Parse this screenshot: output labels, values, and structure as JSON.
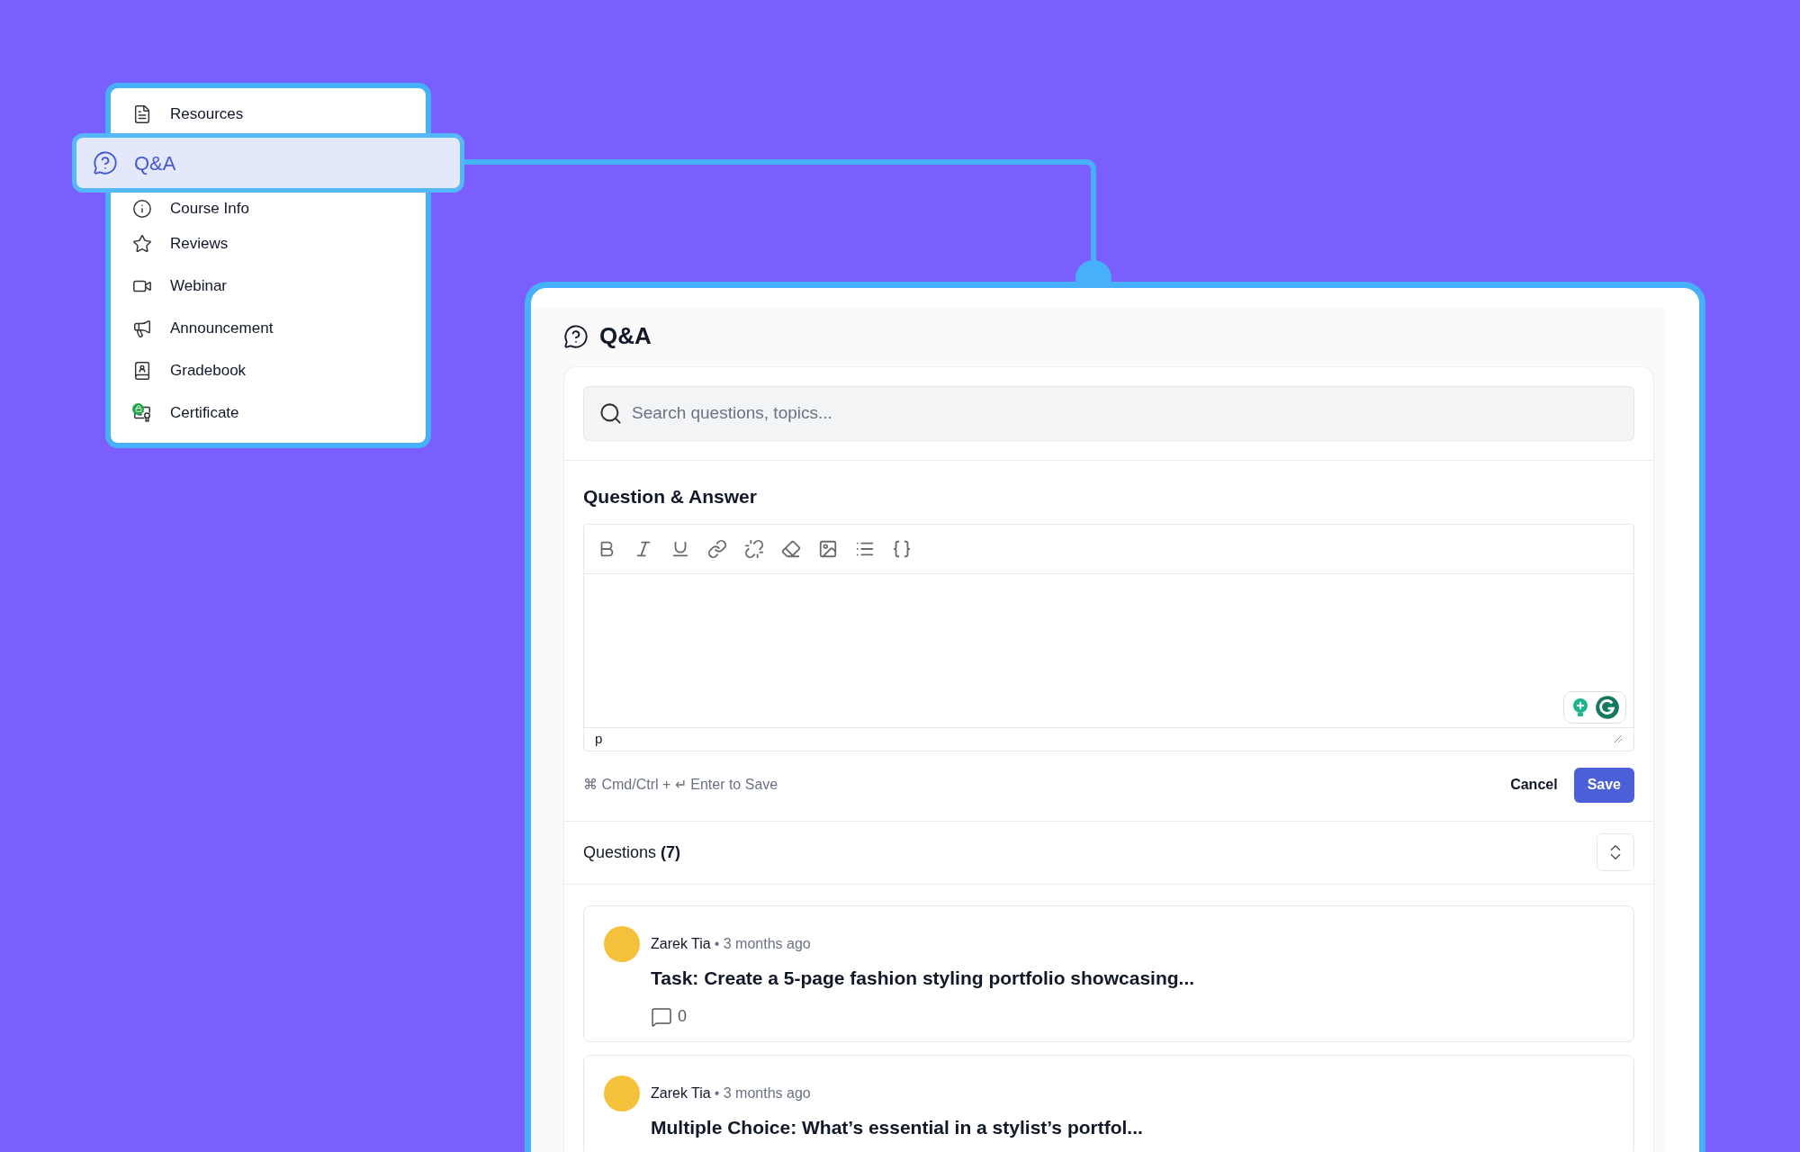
{
  "sidebar": {
    "items": [
      {
        "label": "Resources",
        "selected": false,
        "locked": false
      },
      {
        "label": "Q&A",
        "selected": true,
        "locked": false
      },
      {
        "label": "Course Info",
        "selected": false,
        "locked": false
      },
      {
        "label": "Reviews",
        "selected": false,
        "locked": false
      },
      {
        "label": "Webinar",
        "selected": false,
        "locked": false
      },
      {
        "label": "Announcement",
        "selected": false,
        "locked": false
      },
      {
        "label": "Gradebook",
        "selected": false,
        "locked": false
      },
      {
        "label": "Certificate",
        "selected": false,
        "locked": true
      }
    ]
  },
  "panel": {
    "title": "Q&A",
    "search": {
      "placeholder": "Search questions, topics..."
    },
    "editor": {
      "heading": "Question & Answer",
      "path": "p",
      "hint": "⌘ Cmd/Ctrl + ↵ Enter to Save",
      "buttons": [
        "Cancel",
        "Save"
      ]
    },
    "questions": {
      "heading": "Questions **(7)**",
      "items": [
        {
          "author": "Zarek Tia",
          "time": "• 3 months ago",
          "title": "Task: Create a 5-page fashion styling portfolio showcasing...",
          "comments": "0"
        },
        {
          "author": "Zarek Tia",
          "time": "• 3 months ago",
          "title": "Multiple Choice: What’s essential in a stylist’s portfol..."
        }
      ]
    }
  }
}
